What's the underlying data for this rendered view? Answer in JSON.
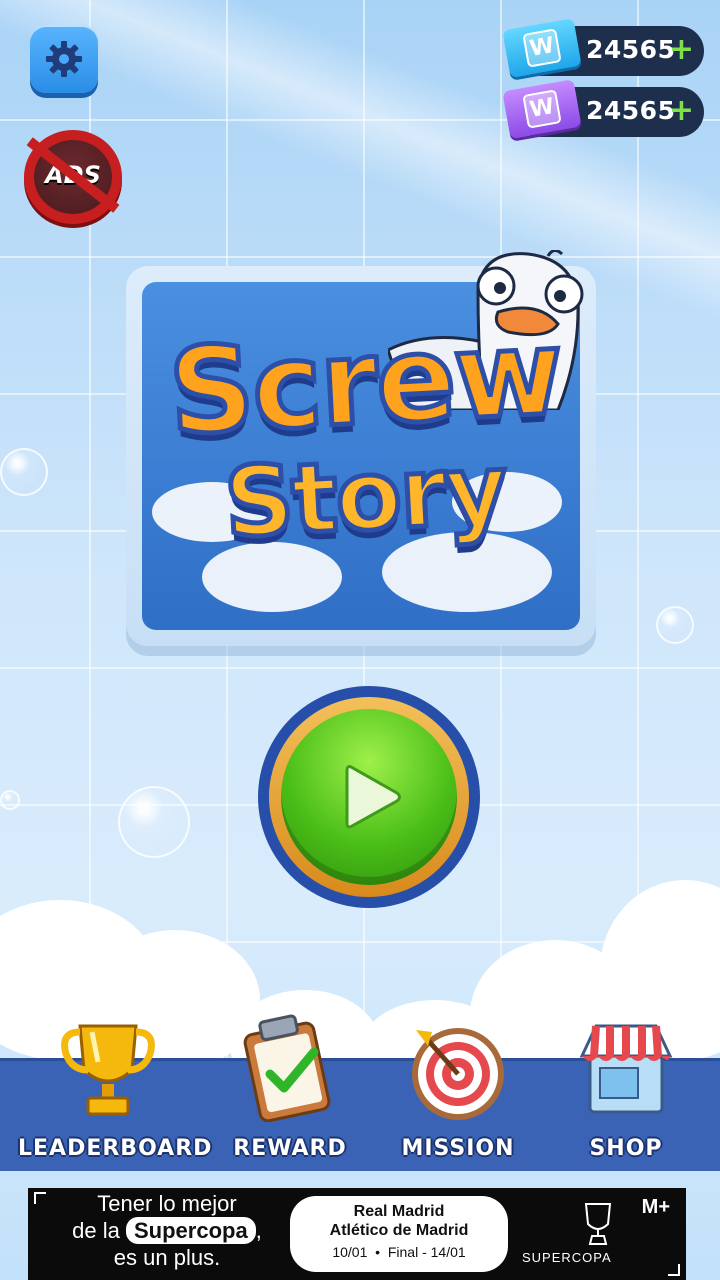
{
  "game": {
    "title_line1": "Screw",
    "title_line2": "Story"
  },
  "top_left": {
    "settings_icon": "gear-icon",
    "no_ads_label": "ADS"
  },
  "currency": [
    {
      "icon": "blue-ticket-icon",
      "ticket_letter": "W",
      "value": "24565",
      "add": "+",
      "color": "#29b6f6"
    },
    {
      "icon": "purple-ticket-icon",
      "ticket_letter": "W",
      "value": "24565",
      "add": "+",
      "color": "#9b59f0"
    }
  ],
  "play": {
    "icon": "play-icon"
  },
  "nav": [
    {
      "label": "LEADERBOARD",
      "icon": "trophy-icon"
    },
    {
      "label": "REWARD",
      "icon": "clipboard-check-icon"
    },
    {
      "label": "MISSION",
      "icon": "target-dart-icon"
    },
    {
      "label": "SHOP",
      "icon": "shop-icon"
    }
  ],
  "ad": {
    "line1": "Tener lo mejor",
    "line2_pre": "de la",
    "line2_pill": "Supercopa",
    "line2_post": ",",
    "line3": "es un plus.",
    "match_home": "Real Madrid",
    "match_away": "Atlético de Madrid",
    "date_left": "10/01",
    "dot": "•",
    "date_right": "Final - 14/01",
    "brand": "SUPERCOPA",
    "mplus": "M+"
  },
  "colors": {
    "nav_bg": "#3a63b5",
    "play_green": "#4bbe18",
    "title_orange": "#ffa21e",
    "no_ads_red": "#c71f1f"
  }
}
